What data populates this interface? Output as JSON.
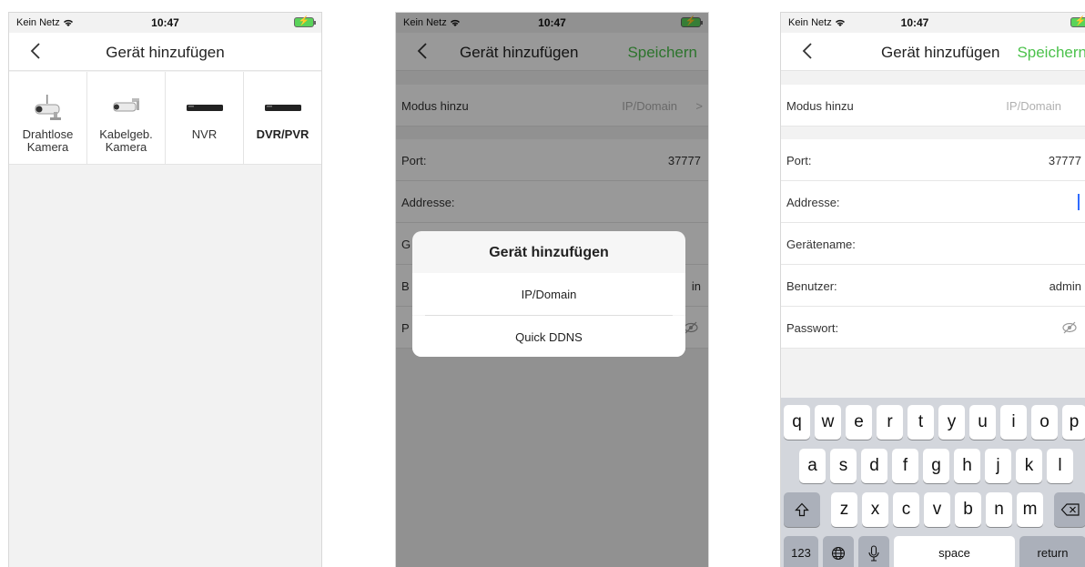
{
  "status": {
    "carrier": "Kein Netz",
    "time": "10:47"
  },
  "screen1": {
    "title": "Gerät hinzufügen",
    "devices": [
      {
        "label": "Drahtlose\nKamera",
        "icon": "wireless-camera-icon"
      },
      {
        "label": "Kabelgeb.\nKamera",
        "icon": "wired-camera-icon"
      },
      {
        "label": "NVR",
        "icon": "nvr-icon"
      },
      {
        "label": "DVR/PVR",
        "icon": "dvr-icon"
      }
    ]
  },
  "screen2": {
    "title": "Gerät hinzufügen",
    "save": "Speichern",
    "mode_label": "Modus hinzu",
    "mode_value": "IP/Domain",
    "port_label": "Port:",
    "port_value": "37777",
    "address_label": "Addresse:",
    "sheet": {
      "title": "Gerät hinzufügen",
      "options": [
        "IP/Domain",
        "Quick DDNS"
      ]
    },
    "hidden_row_letters": [
      "G",
      "B",
      "P"
    ],
    "user_value_partial": "in"
  },
  "screen3": {
    "title": "Gerät hinzufügen",
    "save": "Speichern",
    "mode_label": "Modus hinzu",
    "mode_value": "IP/Domain",
    "port_label": "Port:",
    "port_value": "37777",
    "address_label": "Addresse:",
    "name_label": "Gerätename:",
    "user_label": "Benutzer:",
    "user_value": "admin",
    "password_label": "Passwort:"
  },
  "keyboard": {
    "row1": [
      "q",
      "w",
      "e",
      "r",
      "t",
      "y",
      "u",
      "i",
      "o",
      "p"
    ],
    "row2": [
      "a",
      "s",
      "d",
      "f",
      "g",
      "h",
      "j",
      "k",
      "l"
    ],
    "row3": [
      "z",
      "x",
      "c",
      "v",
      "b",
      "n",
      "m"
    ],
    "numbers": "123",
    "space": "space",
    "return": "return"
  },
  "colors": {
    "accent": "#4cc24c",
    "cursor": "#2f6bff"
  }
}
